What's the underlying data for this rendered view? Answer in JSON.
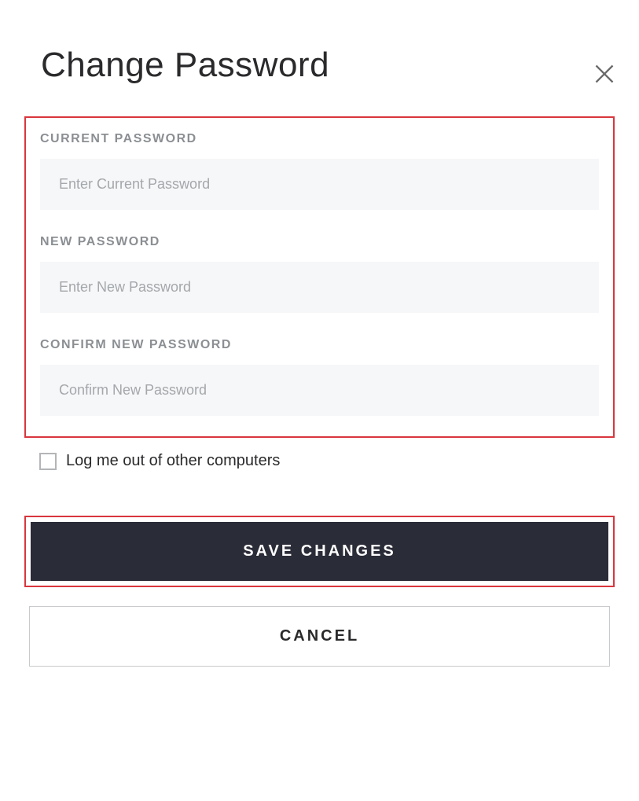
{
  "dialog": {
    "title": "Change Password"
  },
  "fields": {
    "current": {
      "label": "CURRENT PASSWORD",
      "placeholder": "Enter Current Password",
      "value": ""
    },
    "new": {
      "label": "NEW PASSWORD",
      "placeholder": "Enter New Password",
      "value": ""
    },
    "confirm": {
      "label": "CONFIRM NEW PASSWORD",
      "placeholder": "Confirm New Password",
      "value": ""
    }
  },
  "logout_checkbox": {
    "label": "Log me out of other computers",
    "checked": false
  },
  "buttons": {
    "save": "SAVE CHANGES",
    "cancel": "CANCEL"
  },
  "highlight_color": "#d9363e"
}
